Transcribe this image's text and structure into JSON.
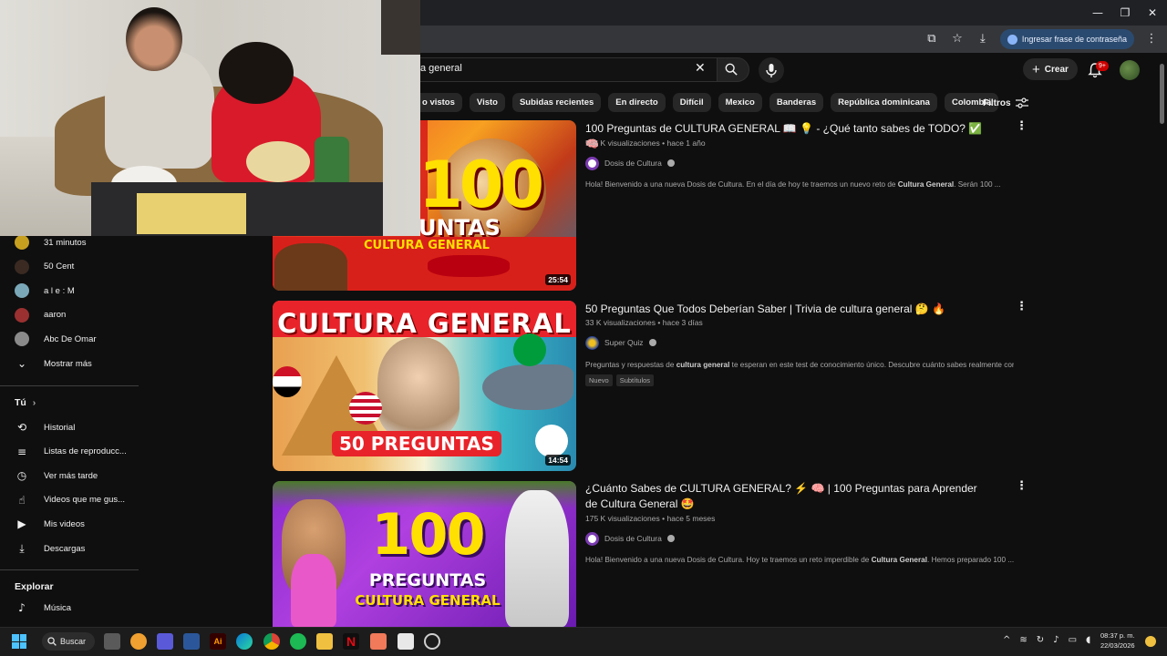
{
  "browser": {
    "passphrase_label": "Ingresar frase de contraseña",
    "win_minimize": "—",
    "win_restore": "❐",
    "win_close": "✕"
  },
  "header": {
    "search_value": "a general",
    "create_label": "Crear",
    "notif_count": "9+"
  },
  "chips": [
    "o vistos",
    "Visto",
    "Subidas recientes",
    "En directo",
    "Difícil",
    "Mexico",
    "Banderas",
    "República dominicana",
    "Colombia"
  ],
  "filters_label": "Filtros",
  "sidebar": {
    "subscriptions": [
      {
        "label": "31 minutos",
        "color": "#c8a020"
      },
      {
        "label": "50 Cent",
        "color": "#3a2a22"
      },
      {
        "label": "a l e : M",
        "color": "#7aa8b8"
      },
      {
        "label": "aaron",
        "color": "#9a3030"
      },
      {
        "label": "Abc De Omar",
        "color": "#8a8a8a"
      }
    ],
    "show_more": "Mostrar más",
    "you_heading": "Tú",
    "you_chevron": "›",
    "you_items": [
      "Historial",
      "Listas de reproducc...",
      "Ver más tarde",
      "Videos que me gus...",
      "Mis videos",
      "Descargas"
    ],
    "explore_heading": "Explorar",
    "explore_items": [
      "Música"
    ]
  },
  "videos": [
    {
      "title": "100 Preguntas de CULTURA GENERAL 📖 💡 - ¿Qué tanto sabes de TODO? ✅ 🧠",
      "views": "546 K visualizaciones",
      "age": "hace 1 año",
      "channel": "Dosis de Cultura",
      "description_pre": "Hola! Bienvenido a una nueva Dosis de Cultura. En el día de hoy te traemos un nuevo reto de ",
      "description_bold": "Cultura General",
      "description_post": ". Serán 100 ...",
      "duration": "25:54",
      "thumb_line1": "100",
      "thumb_line2": "UNTAS",
      "thumb_line3": "CULTURA GENERAL"
    },
    {
      "title": "50 Preguntas Que Todos Deberían Saber | Trivia de cultura general 🤔 🔥",
      "views": "33 K visualizaciones",
      "age": "hace 3 días",
      "channel": "Super Quiz",
      "description_pre": "Preguntas y respuestas de ",
      "description_bold": "cultura general",
      "description_post": " te esperan en este test de conocimiento único. Descubre cuánto sabes realmente con ...",
      "badges": [
        "Nuevo",
        "Subtítulos"
      ],
      "duration": "14:54",
      "thumb_line1": "CULTURA GENERAL",
      "thumb_line2": "50 PREGUNTAS"
    },
    {
      "title": "¿Cuánto Sabes de CULTURA GENERAL? ⚡ 🧠 | 100 Preguntas para Aprender de Cultura General 🤩",
      "views": "175 K visualizaciones",
      "age": "hace 5 meses",
      "channel": "Dosis de Cultura",
      "description_pre": "Hola! Bienvenido a una nueva Dosis de Cultura. Hoy te traemos un reto imperdible de ",
      "description_bold": "Cultura General",
      "description_post": ". Hemos preparado 100 ...",
      "thumb_line1": "100",
      "thumb_line2": "PREGUNTAS",
      "thumb_line3": "CULTURA GENERAL"
    }
  ],
  "meta_sep": "•",
  "taskbar": {
    "search_label": "Buscar",
    "time": "08:37 p. m.",
    "date": "22/03/2026"
  }
}
